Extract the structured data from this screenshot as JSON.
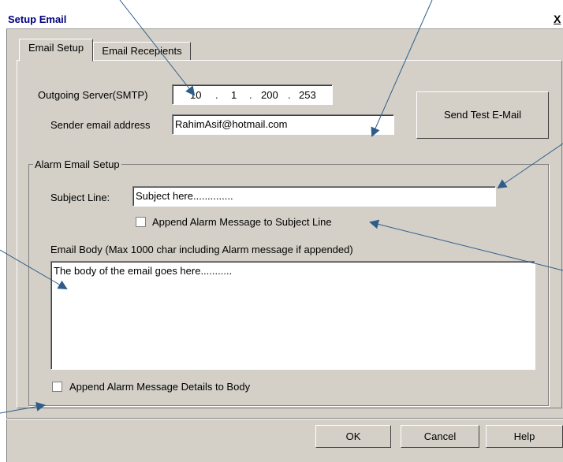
{
  "window": {
    "title": "Setup Email",
    "close_label": "X"
  },
  "tabs": [
    {
      "label": "Email Setup",
      "active": true
    },
    {
      "label": "Email Recepients",
      "active": false
    }
  ],
  "server": {
    "label": "Outgoing Server(SMTP)",
    "ip_parts": [
      "10",
      "1",
      "200",
      "253"
    ],
    "dot": "."
  },
  "sender": {
    "label": "Sender email address",
    "value": "RahimAsif@hotmail.com"
  },
  "test_button": "Send Test E-Mail",
  "alarm_group": {
    "legend": "Alarm Email Setup",
    "subject_label": "Subject Line:",
    "subject_value": "Subject here..............",
    "append_subject_label": "Append Alarm Message to Subject Line",
    "body_label": "Email Body (Max 1000 char including Alarm message if appended)",
    "body_value": "The body of the email goes here...........",
    "append_body_label": "Append Alarm Message Details to Body"
  },
  "footer": {
    "ok": "OK",
    "cancel": "Cancel",
    "help": "Help"
  },
  "colors": {
    "dialog_bg": "#d4d0c8",
    "title_text": "#000080",
    "arrow": "#2f5d8a"
  }
}
